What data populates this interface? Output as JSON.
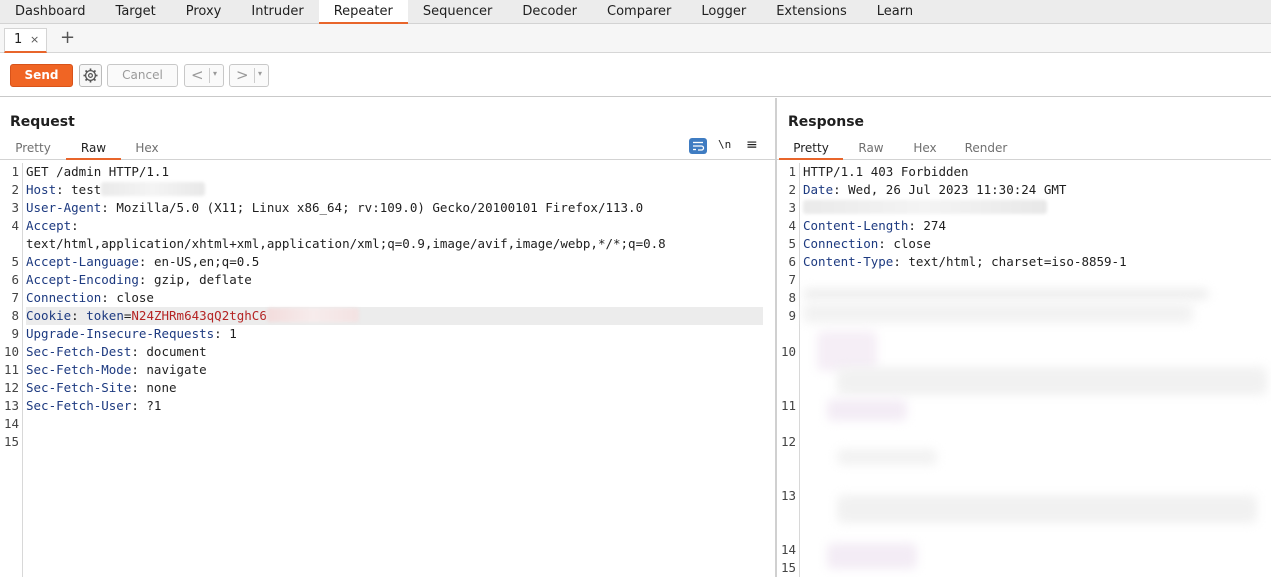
{
  "topnav": [
    "Dashboard",
    "Target",
    "Proxy",
    "Intruder",
    "Repeater",
    "Sequencer",
    "Decoder",
    "Comparer",
    "Logger",
    "Extensions",
    "Learn"
  ],
  "active_tab": "Repeater",
  "subtab": {
    "label": "1",
    "close": "×",
    "add": "+"
  },
  "toolbar": {
    "send": "Send",
    "cancel": "Cancel",
    "back": "<",
    "forward": ">",
    "dropdown": "▾"
  },
  "request": {
    "title": "Request",
    "tabs": [
      "Pretty",
      "Raw",
      "Hex"
    ],
    "active_tab": "Raw",
    "newline_toggle": "\\n",
    "menu": "≡",
    "line_numbers": [
      "1",
      "2",
      "3",
      "4",
      "",
      "5",
      "6",
      "7",
      "8",
      "9",
      "10",
      "11",
      "12",
      "13",
      "14",
      "15"
    ],
    "lines": [
      {
        "name": "",
        "value": "GET /admin HTTP/1.1"
      },
      {
        "name": "Host",
        "value": ": test"
      },
      {
        "name": "User-Agent",
        "value": ": Mozilla/5.0 (X11; Linux x86_64; rv:109.0) Gecko/20100101 Firefox/113.0"
      },
      {
        "name": "Accept",
        "value": ":"
      },
      {
        "name": "",
        "value": "text/html,application/xhtml+xml,application/xml;q=0.9,image/avif,image/webp,*/*;q=0.8"
      },
      {
        "name": "Accept-Language",
        "value": ": en-US,en;q=0.5"
      },
      {
        "name": "Accept-Encoding",
        "value": ": gzip, deflate"
      },
      {
        "name": "Connection",
        "value": ": close"
      },
      {
        "name": "Cookie",
        "value": ": ",
        "cookie_name": "token",
        "cookie_eq": "=",
        "cookie_value": "N24ZHRm643qQ2tghC6"
      },
      {
        "name": "Upgrade-Insecure-Requests",
        "value": ": 1"
      },
      {
        "name": "Sec-Fetch-Dest",
        "value": ": document"
      },
      {
        "name": "Sec-Fetch-Mode",
        "value": ": navigate"
      },
      {
        "name": "Sec-Fetch-Site",
        "value": ": none"
      },
      {
        "name": "Sec-Fetch-User",
        "value": ": ?1"
      },
      {
        "name": "",
        "value": ""
      },
      {
        "name": "",
        "value": ""
      }
    ]
  },
  "response": {
    "title": "Response",
    "tabs": [
      "Pretty",
      "Raw",
      "Hex",
      "Render"
    ],
    "active_tab": "Pretty",
    "line_numbers": [
      "1",
      "2",
      "3",
      "4",
      "5",
      "6",
      "7",
      "8",
      "9",
      "10",
      "11",
      "12",
      "13",
      "14",
      "15"
    ],
    "lines": [
      {
        "name": "",
        "value": "HTTP/1.1 403 Forbidden"
      },
      {
        "name": "Date",
        "value": ": Wed, 26 Jul 2023 11:30:24 GMT"
      },
      {
        "name": "",
        "value": ""
      },
      {
        "name": "Content-Length",
        "value": ": 274"
      },
      {
        "name": "Connection",
        "value": ": close"
      },
      {
        "name": "Content-Type",
        "value": ": text/html; charset=iso-8859-1"
      }
    ]
  },
  "colors": {
    "accent": "#e8652b",
    "send": "#f06524",
    "header_name": "#1d3a80",
    "cookie_value": "#b52424"
  }
}
